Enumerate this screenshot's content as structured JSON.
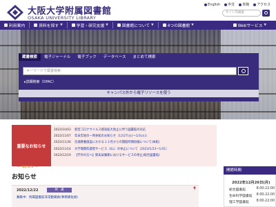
{
  "header": {
    "title_jp": "大阪大学附属図書館",
    "title_en": "OSAKA UNIVERSITY LIBRARY",
    "util_links": [
      "English",
      "中文",
      "本館",
      "アクセス"
    ],
    "search_placeholder": "サイト内検索"
  },
  "nav": {
    "items": [
      "利用案内",
      "資料を探す",
      "学習・研究支援",
      "図書館について",
      "4つの図書館"
    ],
    "web_service": "Webサービス"
  },
  "search": {
    "tabs": [
      "蔵書検索",
      "電子ジャーナル",
      "電子ブック",
      "データベース",
      "まとめて検索"
    ],
    "keyword_placeholder": "キーワードで蔵書検索",
    "advanced_link": "▸詳細検索（OPAC）",
    "remote_access": "キャンパス外から電子リソースを使う"
  },
  "notice": {
    "heading": "重要なお知らせ",
    "items": [
      {
        "date": "2022/10/03",
        "text": "新型コロナウイルス感染拡大防止に伴う図書館の対応"
      },
      {
        "date": "2022/11/07",
        "text": "年末年始の一時休館のお知らせ（12/27(火)～1/3(火)）"
      },
      {
        "date": "2022/11/30",
        "text": "先端教養施設にかかる１２月からの開館時間短縮について(本館)"
      },
      {
        "date": "2022/11/14",
        "text": "大学間資料貸借サービス（ILL）の休止について（2023/1/23～1/31）"
      },
      {
        "date": "2022/12/19",
        "text": "【学外の方へ】期末試験期におけるサービスの停止(総合図書館)"
      }
    ]
  },
  "news": {
    "label_en": "— NEWS —",
    "heading": "お知らせ",
    "items": [
      {
        "date": "2022/12/22",
        "badge": "共　通",
        "title": "募集中：附属図書館非常勤職員(事務補佐員)"
      }
    ]
  },
  "hours": {
    "heading": "開館時間",
    "date": "2022年12月26日(月)",
    "rows": [
      {
        "name": "総合図書館",
        "time": "8:00-22:00"
      },
      {
        "name": "生命科学図書館",
        "time": "8:00-22:00"
      },
      {
        "name": "理工学図書館",
        "time": "8:00-22:00"
      }
    ]
  },
  "colors": {
    "brand": "#3b2a82",
    "notice_red": "#c53b3b",
    "link_blue": "#1f3b9a"
  }
}
